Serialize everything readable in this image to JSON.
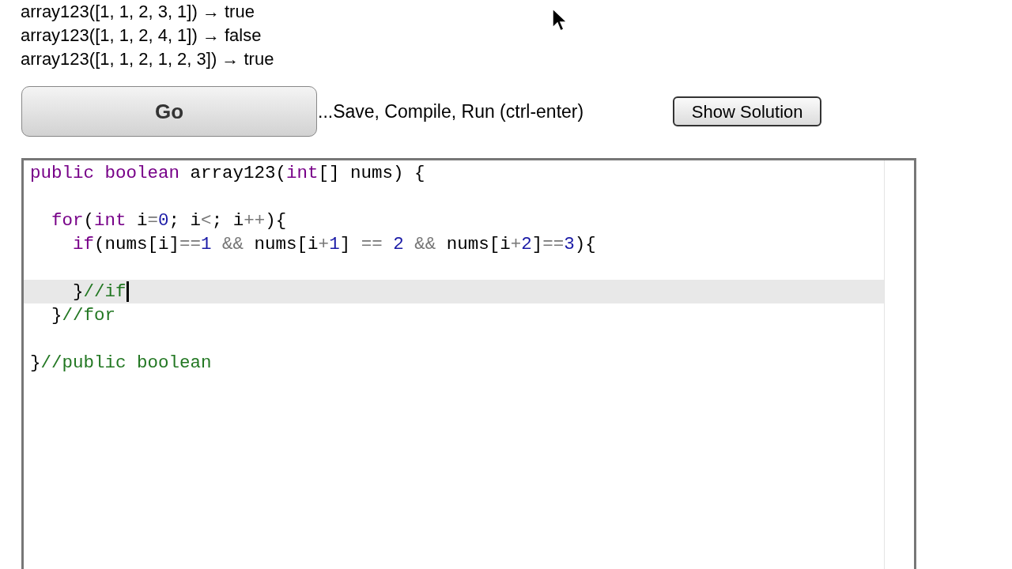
{
  "examples": [
    "array123([1, 1, 2, 3, 1]) → true",
    "array123([1, 1, 2, 4, 1]) → false",
    "array123([1, 1, 2, 1, 2, 3]) → true"
  ],
  "go_button": "Go",
  "go_hint": "...Save, Compile, Run (ctrl-enter)",
  "solution_button": "Show Solution",
  "editor": {
    "blocks": [
      {
        "lines": [
          {
            "selected": false,
            "tokens": [
              {
                "kind": "keyword",
                "text": "public boolean"
              },
              {
                "kind": "plain",
                "text": " array123("
              },
              {
                "kind": "keyword",
                "text": "int"
              },
              {
                "kind": "plain",
                "text": "[] nums) {"
              }
            ]
          }
        ]
      },
      {
        "lines": [
          {
            "selected": false,
            "tokens": [
              {
                "kind": "keyword",
                "text": "  for"
              },
              {
                "kind": "plain",
                "text": "("
              },
              {
                "kind": "keyword",
                "text": "int"
              },
              {
                "kind": "plain",
                "text": " i"
              },
              {
                "kind": "operator",
                "text": "="
              },
              {
                "kind": "number",
                "text": "0"
              },
              {
                "kind": "plain",
                "text": "; i"
              },
              {
                "kind": "operator",
                "text": "<"
              },
              {
                "kind": "plain",
                "text": "; i"
              },
              {
                "kind": "operator",
                "text": "++"
              },
              {
                "kind": "plain",
                "text": "){"
              }
            ]
          },
          {
            "selected": false,
            "tokens": [
              {
                "kind": "keyword",
                "text": "    if"
              },
              {
                "kind": "plain",
                "text": "(nums[i]"
              },
              {
                "kind": "operator",
                "text": "=="
              },
              {
                "kind": "number",
                "text": "1 "
              },
              {
                "kind": "operator",
                "text": "&&"
              },
              {
                "kind": "plain",
                "text": " nums[i"
              },
              {
                "kind": "operator",
                "text": "+"
              },
              {
                "kind": "number",
                "text": "1"
              },
              {
                "kind": "plain",
                "text": "] "
              },
              {
                "kind": "operator",
                "text": "== "
              },
              {
                "kind": "number",
                "text": "2 "
              },
              {
                "kind": "operator",
                "text": "&&"
              },
              {
                "kind": "plain",
                "text": " nums[i"
              },
              {
                "kind": "operator",
                "text": "+"
              },
              {
                "kind": "number",
                "text": "2"
              },
              {
                "kind": "plain",
                "text": "]"
              },
              {
                "kind": "operator",
                "text": "=="
              },
              {
                "kind": "number",
                "text": "3"
              },
              {
                "kind": "plain",
                "text": "){"
              }
            ]
          }
        ]
      },
      {
        "lines": [
          {
            "selected": true,
            "tokens": [
              {
                "kind": "plain",
                "text": "    }"
              },
              {
                "kind": "comment",
                "text": "//if"
              }
            ]
          },
          {
            "selected": false,
            "tokens": [
              {
                "kind": "plain",
                "text": "  }"
              },
              {
                "kind": "comment",
                "text": "//for"
              }
            ]
          }
        ]
      },
      {
        "lines": [
          {
            "selected": false,
            "tokens": [
              {
                "kind": "plain",
                "text": "}"
              },
              {
                "kind": "comment",
                "text": "//public boolean"
              }
            ]
          }
        ]
      }
    ]
  }
}
